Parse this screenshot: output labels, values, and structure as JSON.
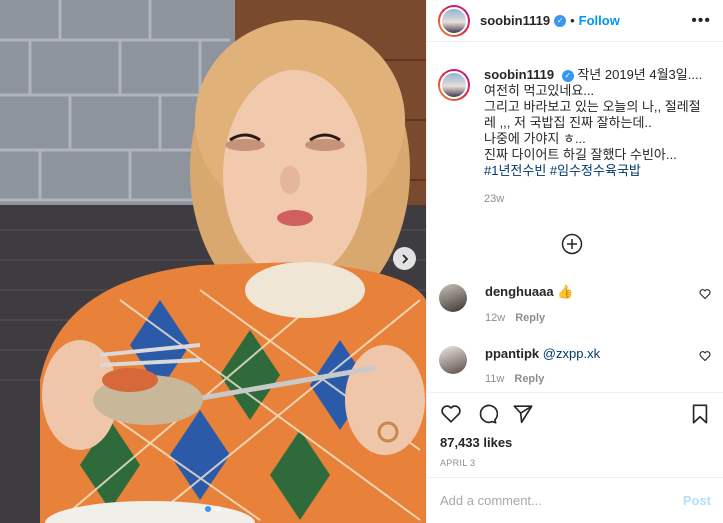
{
  "header": {
    "username": "soobin1119",
    "separator": "•",
    "follow_label": "Follow",
    "more_icon": "more-horizontal-icon"
  },
  "caption": {
    "username": "soobin1119",
    "lines": [
      "작년 2019년 4월3일....",
      "여전히 먹고있네요...",
      "그리고 바라보고 있는 오늘의 나,, 절레절레 ,,, 저 국밥집 진짜 잘하는데..",
      "나중에 가야지 ㅎ...",
      "진짜 다이어트 하길 잘했다 수빈아..."
    ],
    "hashtags": "#1년전수빈 #임수정수육국밥",
    "time": "23w"
  },
  "comments": [
    {
      "username": "denghuaaa",
      "text": "👍",
      "time": "12w",
      "reply_label": "Reply"
    },
    {
      "username": "ppantipk",
      "text": "@zxpp.xk",
      "time": "11w",
      "reply_label": "Reply"
    }
  ],
  "actions": {
    "likes": "87,433 likes",
    "date": "April 3"
  },
  "composer": {
    "placeholder": "Add a comment...",
    "post_label": "Post"
  },
  "colors": {
    "accent": "#0095f6",
    "verified": "#3897f0",
    "muted": "#8e8e8e",
    "post_disabled": "#b2dffc"
  }
}
